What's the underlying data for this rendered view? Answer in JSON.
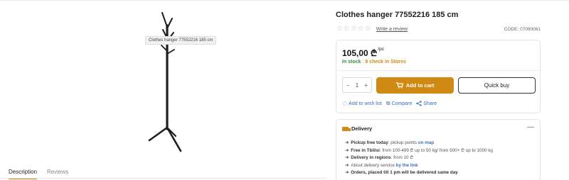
{
  "gallery": {
    "tooltip": "Clothes hanger 77552216 185 cm",
    "image_icon": "coat-stand-icon"
  },
  "tabs": [
    {
      "label": "Description",
      "active": true
    },
    {
      "label": "Reviews",
      "active": false
    }
  ],
  "product": {
    "title": "Clothes hanger 77552216 185 cm",
    "rating_stars": 0,
    "rating_max": 5,
    "review_link": "Write a review",
    "code": "CODE: 07090061"
  },
  "purchase": {
    "price": "105,00",
    "currency_symbol": "₾",
    "unit": "/pc",
    "stock_label": "In stock",
    "stock_separator": ":",
    "stock_count": "8",
    "check_label": "check in Stores",
    "quantity": "1",
    "minus": "−",
    "plus": "+",
    "add_to_cart": "Add to cart",
    "quick_buy": "Quick buy",
    "wishlist": "Add to wish list",
    "compare": "Compare",
    "share": "Share",
    "accent_color": "#d08a14"
  },
  "delivery": {
    "title": "Delivery",
    "collapse": "—",
    "items": [
      {
        "bold": "Pickup free today",
        "text": ": pickup points ",
        "link": "on map"
      },
      {
        "bold": "Free in Tbilisi",
        "text": ": from 100-499 ₾ up to 50 kg/ from 500+ ₾ up to 1000 kg",
        "link": ""
      },
      {
        "bold": "Delivery in regions",
        "text": ": from 10 ₾",
        "link": ""
      },
      {
        "bold": "",
        "text": "About delivery service ",
        "link": "by the link"
      },
      {
        "bold": "Orders, placed till 1 pm will be delivered same day",
        "text": "",
        "link": ""
      }
    ]
  }
}
